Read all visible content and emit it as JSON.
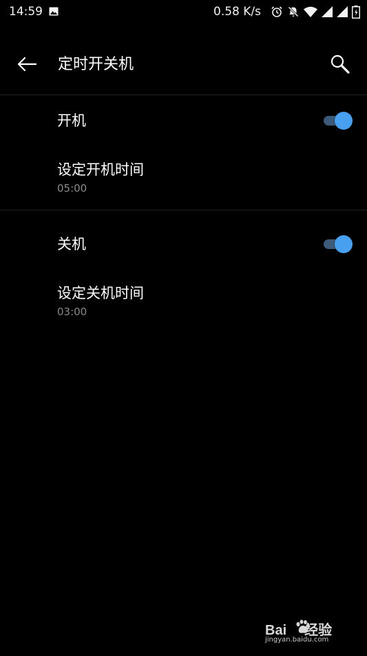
{
  "status_bar": {
    "time": "14:59",
    "net_speed": "0.58 K/s",
    "icons": [
      "gallery-icon",
      "alarm-icon",
      "bell-off-icon",
      "wifi-icon",
      "signal-icon",
      "signal-icon",
      "battery-icon"
    ]
  },
  "app_bar": {
    "title": "定时开关机",
    "back_icon": "arrow-left-icon",
    "search_icon": "search-icon"
  },
  "settings": {
    "power_on": {
      "label": "开机",
      "enabled": true,
      "time_label": "设定开机时间",
      "time_value": "05:00"
    },
    "power_off": {
      "label": "关机",
      "enabled": true,
      "time_label": "设定关机时间",
      "time_value": "03:00"
    }
  },
  "watermark": {
    "brand_a": "Bai",
    "brand_b": "经验",
    "url": "jingyan.baidu.com"
  },
  "colors": {
    "background": "#000000",
    "accent": "#4aa0f0",
    "toggle_track": "#3c5a7a",
    "secondary_text": "#8a8a8a"
  }
}
